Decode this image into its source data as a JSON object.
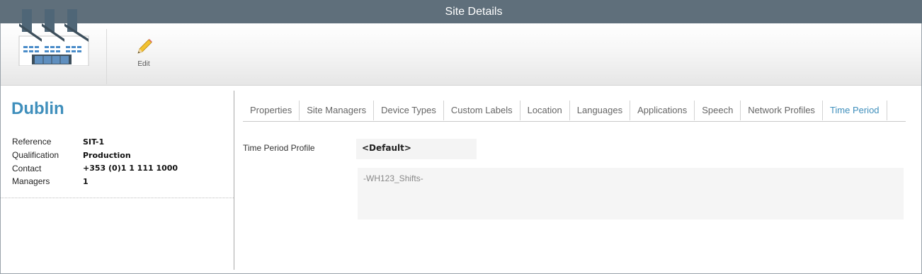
{
  "window": {
    "title": "Site Details"
  },
  "toolbar": {
    "site_icon": "factory-icon",
    "edit": {
      "icon": "pencil-icon",
      "label": "Edit"
    }
  },
  "site": {
    "name": "Dublin",
    "details": [
      {
        "label": "Reference",
        "value": "SIT-1"
      },
      {
        "label": "Qualification",
        "value": "Production"
      },
      {
        "label": "Contact",
        "value": "+353 (0)1 1 111 1000"
      },
      {
        "label": "Managers",
        "value": "1"
      }
    ]
  },
  "tabs": [
    {
      "label": "Properties",
      "active": false
    },
    {
      "label": "Site Managers",
      "active": false
    },
    {
      "label": "Device Types",
      "active": false
    },
    {
      "label": "Custom Labels",
      "active": false
    },
    {
      "label": "Location",
      "active": false
    },
    {
      "label": "Languages",
      "active": false
    },
    {
      "label": "Applications",
      "active": false
    },
    {
      "label": "Speech",
      "active": false
    },
    {
      "label": "Network Profiles",
      "active": false
    },
    {
      "label": "Time Period",
      "active": true
    }
  ],
  "time_period": {
    "label": "Time Period Profile",
    "selected": "<Default>",
    "detail": "-WH123_Shifts-"
  },
  "colors": {
    "titlebar": "#5f6f7b",
    "accent": "#3f8fbc"
  }
}
